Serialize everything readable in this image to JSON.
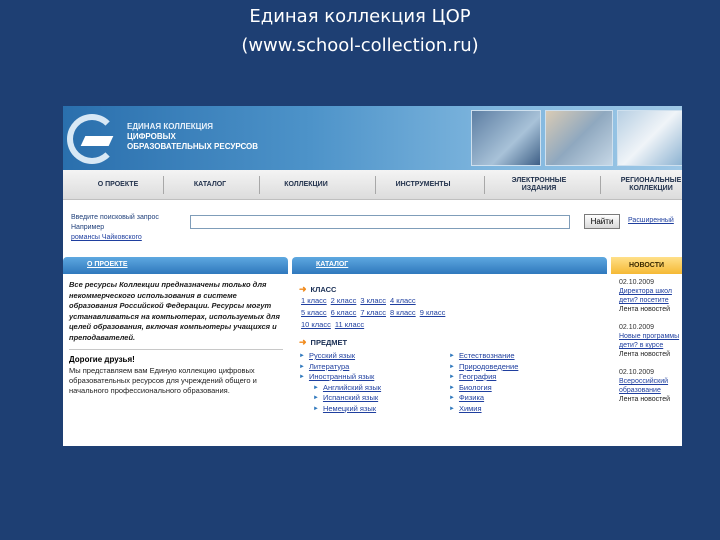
{
  "slide": {
    "title_line1": "Единая коллекция ЦОР",
    "title_line2": "(www.school-collection.ru)"
  },
  "header": {
    "logo_line1": "ЕДИНАЯ КОЛЛЕКЦИЯ",
    "logo_line2": "ЦИФРОВЫХ",
    "logo_line3": "ОБРАЗОВАТЕЛЬНЫХ РЕСУРСОВ"
  },
  "nav": [
    {
      "label": "О ПРОЕКТЕ"
    },
    {
      "label": "КАТАЛОГ"
    },
    {
      "label": "КОЛЛЕКЦИИ"
    },
    {
      "label": "ИНСТРУМЕНТЫ"
    },
    {
      "label": "ЭЛЕКТРОННЫЕ ИЗДАНИЯ"
    },
    {
      "label": "РЕГИОНАЛЬНЫЕ КОЛЛЕКЦИИ"
    }
  ],
  "search": {
    "hint": "Введите поисковый запрос",
    "example_label": "Например",
    "example_link": "романсы Чайковского",
    "value": "",
    "button": "Найти",
    "advanced": "Расширенный"
  },
  "tabs": {
    "about": "О ПРОЕКТЕ",
    "catalog": "КАТАЛОГ",
    "news": "НОВОСТИ"
  },
  "about": {
    "text": "Все ресурсы Коллекции предназначены только для некоммерческого использования в системе образования Российской Федерации. Ресурсы могут устанавливаться на компьютерах, используемых для целей образования, включая компьютеры учащихся и преподавателей.",
    "greeting": "Дорогие друзья!",
    "greeting_text": "Мы представляем вам Единую коллекцию цифровых образовательных ресурсов для учреждений общего и начального профессионального образования."
  },
  "catalog": {
    "grade_heading": "КЛАСС",
    "grades_row1": [
      "1 класс",
      "2 класс",
      "3 класс",
      "4 класс"
    ],
    "grades_row2": [
      "5 класс",
      "6 класс",
      "7 класс",
      "8 класс",
      "9 класс"
    ],
    "grades_row3": [
      "10 класс",
      "11 класс"
    ],
    "subject_heading": "ПРЕДМЕТ",
    "subjects_left": [
      {
        "label": "Русский язык",
        "sub": false
      },
      {
        "label": "Литература",
        "sub": false
      },
      {
        "label": "Иностранный язык",
        "sub": false
      },
      {
        "label": "Английский язык",
        "sub": true
      },
      {
        "label": "Испанский язык",
        "sub": true
      },
      {
        "label": "Немецкий язык",
        "sub": true
      }
    ],
    "subjects_right": [
      {
        "label": "Естествознание"
      },
      {
        "label": "Природоведение"
      },
      {
        "label": "География"
      },
      {
        "label": "Биология"
      },
      {
        "label": "Физика"
      },
      {
        "label": "Химия"
      }
    ]
  },
  "news": [
    {
      "date": "02.10.2009",
      "title": "Директора школ",
      "title2": "дети? посетите",
      "source": "Лента новостей"
    },
    {
      "date": "02.10.2009",
      "title": "Новые программы",
      "title2": "дети? в курсе",
      "source": "Лента новостей"
    },
    {
      "date": "02.10.2009",
      "title": "Всероссийский",
      "title2": "образование",
      "source": "Лента новостей"
    }
  ],
  "colors": {
    "slide_bg": "#1e3f73",
    "tab_blue": "#2f78bd",
    "tab_news": "#f5b935",
    "link": "#1f3f9f",
    "arrow": "#f08a1c"
  }
}
